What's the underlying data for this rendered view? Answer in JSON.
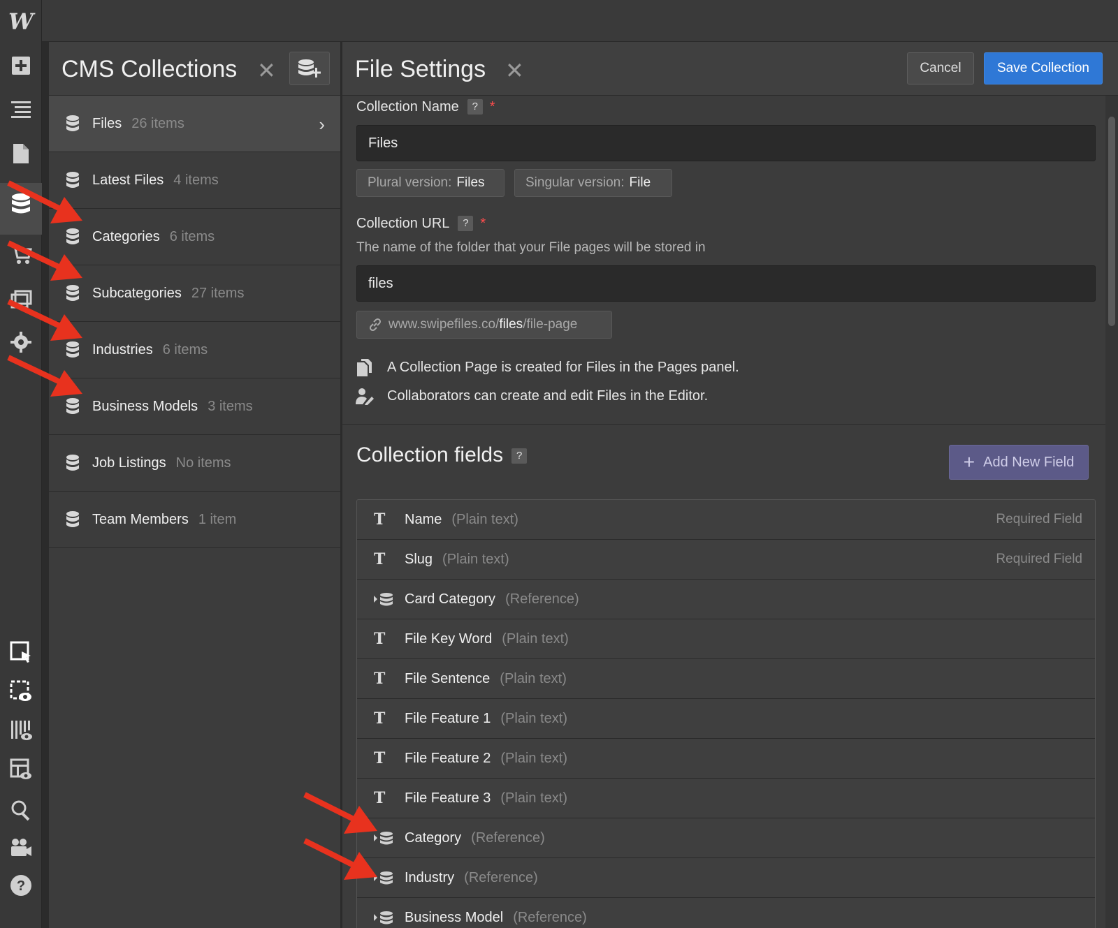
{
  "app": {
    "logo": "W"
  },
  "toolbar": {
    "icons": [
      "add-icon",
      "navigator-icon",
      "pages-icon",
      "cms-icon",
      "ecommerce-icon",
      "assets-icon",
      "settings-icon",
      "select-icon",
      "preview-icon",
      "audit-icon",
      "layout-preview-icon",
      "search-icon",
      "video-icon",
      "help-icon"
    ]
  },
  "cms_panel": {
    "title": "CMS Collections",
    "close": "✕",
    "collections": [
      {
        "name": "Files",
        "count": "26 items"
      },
      {
        "name": "Latest Files",
        "count": "4 items"
      },
      {
        "name": "Categories",
        "count": "6 items"
      },
      {
        "name": "Subcategories",
        "count": "27 items"
      },
      {
        "name": "Industries",
        "count": "6 items"
      },
      {
        "name": "Business Models",
        "count": "3 items"
      },
      {
        "name": "Job Listings",
        "count": "No items"
      },
      {
        "name": "Team Members",
        "count": "1 item"
      }
    ],
    "selected_chevron": "›"
  },
  "settings": {
    "title": "File Settings",
    "close": "✕",
    "cancel_label": "Cancel",
    "save_label": "Save Collection",
    "collection_name_label": "Collection Name",
    "help": "?",
    "required": "*",
    "collection_name_value": "Files",
    "plural_label": "Plural version:",
    "plural_value": "Files",
    "singular_label": "Singular version:",
    "singular_value": "File",
    "collection_url_label": "Collection URL",
    "collection_url_hint": "The name of the folder that your File pages will be stored in",
    "collection_url_value": "files",
    "url_preview_prefix": "www.swipefiles.co/",
    "url_preview_slug": "files",
    "url_preview_suffix": "/file-page",
    "info_pages": "A Collection Page is created for Files in the Pages panel.",
    "info_editor": "Collaborators can create and edit Files in the Editor.",
    "fields_title": "Collection fields",
    "add_field_label": "Add New Field",
    "add_field_plus": "+",
    "fields": [
      {
        "name": "Name",
        "type": "(Plain text)",
        "icon": "T",
        "required": "Required Field"
      },
      {
        "name": "Slug",
        "type": "(Plain text)",
        "icon": "T",
        "required": "Required Field"
      },
      {
        "name": "Card Category",
        "type": "(Reference)",
        "icon": "reference",
        "required": ""
      },
      {
        "name": "File Key Word",
        "type": "(Plain text)",
        "icon": "T",
        "required": ""
      },
      {
        "name": "File Sentence",
        "type": "(Plain text)",
        "icon": "T",
        "required": ""
      },
      {
        "name": "File Feature 1",
        "type": "(Plain text)",
        "icon": "T",
        "required": ""
      },
      {
        "name": "File Feature 2",
        "type": "(Plain text)",
        "icon": "T",
        "required": ""
      },
      {
        "name": "File Feature 3",
        "type": "(Plain text)",
        "icon": "T",
        "required": ""
      },
      {
        "name": "Category",
        "type": "(Reference)",
        "icon": "reference",
        "required": ""
      },
      {
        "name": "Industry",
        "type": "(Reference)",
        "icon": "reference",
        "required": ""
      },
      {
        "name": "Business Model",
        "type": "(Reference)",
        "icon": "reference",
        "required": ""
      }
    ]
  },
  "colors": {
    "accent": "#2f78d6",
    "annotation_arrow": "#e8321e",
    "add_field": "#5c5a88"
  }
}
